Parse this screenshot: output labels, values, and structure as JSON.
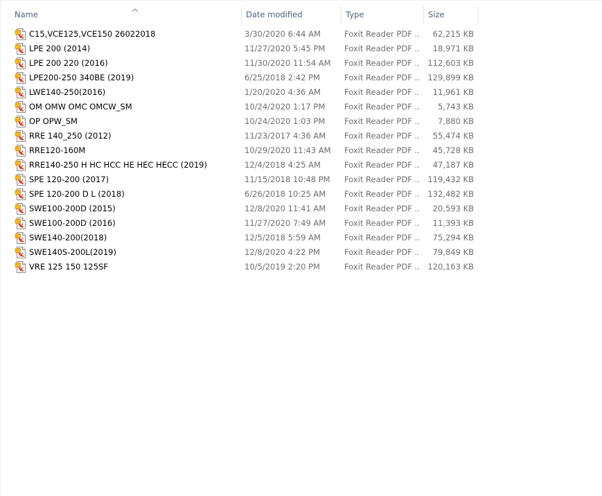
{
  "columns": {
    "name": "Name",
    "date": "Date modified",
    "type": "Type",
    "size": "Size"
  },
  "sort": {
    "column": "name",
    "icon": "sort-ascending-icon"
  },
  "file_icon": "pdf-file-icon",
  "files": [
    {
      "name": "C15,VCE125,VCE150 26022018",
      "date": "3/30/2020 6:44 AM",
      "type": "Foxit Reader PDF ...",
      "size": "62,215 KB"
    },
    {
      "name": "LPE 200 (2014)",
      "date": "11/27/2020 5:45 PM",
      "type": "Foxit Reader PDF ...",
      "size": "18,971 KB"
    },
    {
      "name": "LPE 200 220 (2016)",
      "date": "11/30/2020 11:54 AM",
      "type": "Foxit Reader PDF ...",
      "size": "112,603 KB"
    },
    {
      "name": "LPE200-250 340BE (2019)",
      "date": "6/25/2018 2:42 PM",
      "type": "Foxit Reader PDF ...",
      "size": "129,899 KB"
    },
    {
      "name": "LWE140-250(2016)",
      "date": "1/20/2020 4:36 AM",
      "type": "Foxit Reader PDF ...",
      "size": "11,961 KB"
    },
    {
      "name": "OM OMW OMC OMCW_SM",
      "date": "10/24/2020 1:17 PM",
      "type": "Foxit Reader PDF ...",
      "size": "5,743 KB"
    },
    {
      "name": "OP OPW_SM",
      "date": "10/24/2020 1:03 PM",
      "type": "Foxit Reader PDF ...",
      "size": "7,880 KB"
    },
    {
      "name": "RRE 140_250 (2012)",
      "date": "11/23/2017 4:36 AM",
      "type": "Foxit Reader PDF ...",
      "size": "55,474 KB"
    },
    {
      "name": "RRE120-160M",
      "date": "10/29/2020 11:43 AM",
      "type": "Foxit Reader PDF ...",
      "size": "45,728 KB"
    },
    {
      "name": "RRE140-250 H HC HCC HE HEC HECC (2019)",
      "date": "12/4/2018 4:25 AM",
      "type": "Foxit Reader PDF ...",
      "size": "47,187 KB"
    },
    {
      "name": "SPE 120-200 (2017)",
      "date": "11/15/2018 10:48 PM",
      "type": "Foxit Reader PDF ...",
      "size": "119,432 KB"
    },
    {
      "name": "SPE 120-200 D L (2018)",
      "date": "6/26/2018 10:25 AM",
      "type": "Foxit Reader PDF ...",
      "size": "132,482 KB"
    },
    {
      "name": "SWE100-200D (2015)",
      "date": "12/8/2020 11:41 AM",
      "type": "Foxit Reader PDF ...",
      "size": "20,593 KB"
    },
    {
      "name": "SWE100-200D (2016)",
      "date": "11/27/2020 7:49 AM",
      "type": "Foxit Reader PDF ...",
      "size": "11,393 KB"
    },
    {
      "name": "SWE140-200(2018)",
      "date": "12/5/2018 5:59 AM",
      "type": "Foxit Reader PDF ...",
      "size": "75,294 KB"
    },
    {
      "name": "SWE140S-200L(2019)",
      "date": "12/8/2020 4:22 PM",
      "type": "Foxit Reader PDF ...",
      "size": "79,849 KB"
    },
    {
      "name": "VRE 125 150 125SF",
      "date": "10/5/2019 2:20 PM",
      "type": "Foxit Reader PDF ...",
      "size": "120,163 KB"
    }
  ]
}
